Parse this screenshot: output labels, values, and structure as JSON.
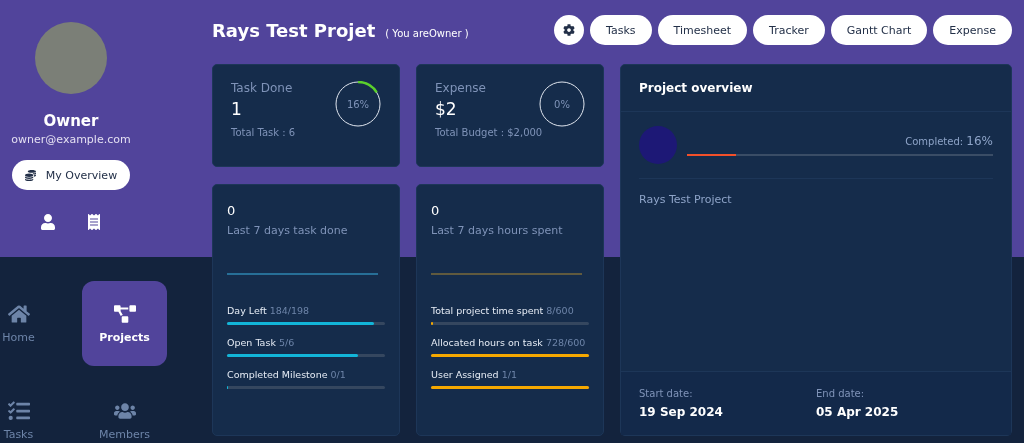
{
  "profile": {
    "name": "Owner",
    "email": "owner@example.com",
    "overview_button": "My Overview"
  },
  "nav": [
    {
      "label": "Home",
      "selected": false
    },
    {
      "label": "Projects",
      "selected": true
    },
    {
      "label": "Tasks",
      "selected": false
    },
    {
      "label": "Members",
      "selected": false
    }
  ],
  "header": {
    "title": "Rays Test Projet",
    "role_note": "( You areOwner )"
  },
  "toolbar": {
    "buttons": [
      "Tasks",
      "Timesheet",
      "Tracker",
      "Gantt Chart",
      "Expense"
    ]
  },
  "summary_cards": [
    {
      "title": "Task Done",
      "value": "1",
      "footer": "Total Task : 6",
      "percent": "16%",
      "level": 0.16
    },
    {
      "title": "Expense",
      "value": "$2",
      "footer": "Total Budget : $2,000",
      "percent": "0%",
      "level": 0
    }
  ],
  "stat_cards": [
    {
      "kind": "tasks",
      "value": "0",
      "caption": "Last 7 days task done",
      "metrics": [
        {
          "label": "Day Left",
          "reading": "184/198",
          "level": 0.93
        },
        {
          "label": "Open Task",
          "reading": "5/6",
          "level": 0.83
        },
        {
          "label": "Completed Milestone",
          "reading": "0/1",
          "level": 0
        }
      ]
    },
    {
      "kind": "hours",
      "value": "0",
      "caption": "Last 7 days hours spent",
      "metrics": [
        {
          "label": "Total project time spent",
          "reading": "8/600",
          "level": 0.013
        },
        {
          "label": "Allocated hours on task",
          "reading": "728/600",
          "level": 1
        },
        {
          "label": "User Assigned",
          "reading": "1/1",
          "level": 1
        }
      ]
    }
  ],
  "overview": {
    "title": "Project overview",
    "completed_label": "Completed:",
    "completed_value": "16%",
    "level": 0.16,
    "project_name": "Rays Test Project",
    "start_label": "Start date:",
    "start_date": "19 Sep 2024",
    "end_label": "End date:",
    "end_date": "05 Apr 2025"
  }
}
